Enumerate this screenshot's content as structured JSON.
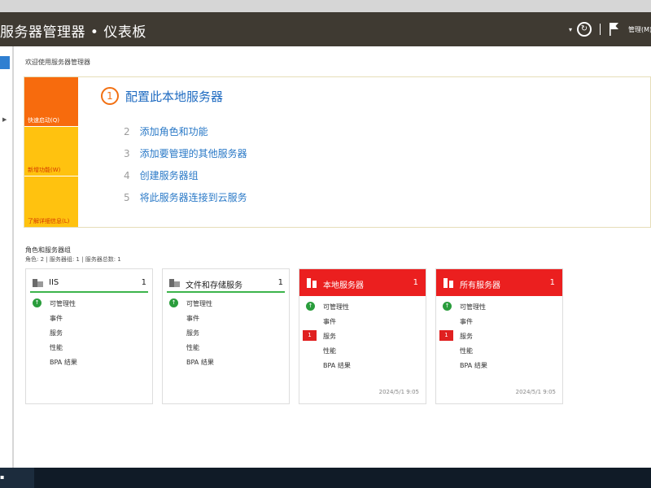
{
  "window": {
    "title": "服务器管理器 • 仪表板",
    "manage_label": "管理(M)"
  },
  "welcome": {
    "title": "欢迎使用服务器管理器",
    "quick_tiles": [
      "快速启动(Q)",
      "新增功能(W)",
      "了解详细信息(L)"
    ],
    "main_step": {
      "number": "1",
      "label": "配置此本地服务器"
    },
    "steps": [
      {
        "number": "2",
        "label": "添加角色和功能"
      },
      {
        "number": "3",
        "label": "添加要管理的其他服务器"
      },
      {
        "number": "4",
        "label": "创建服务器组"
      },
      {
        "number": "5",
        "label": "将此服务器连接到云服务"
      }
    ]
  },
  "roles": {
    "title": "角色和服务器组",
    "summary": "角色: 2 | 服务器组: 1 | 服务器总数: 1"
  },
  "row_labels": [
    "可管理性",
    "事件",
    "服务",
    "性能",
    "BPA 结果"
  ],
  "tiles": [
    {
      "name": "IIS",
      "count": "1",
      "status": "ok",
      "service_alert": "",
      "timestamp": ""
    },
    {
      "name": "文件和存储服务",
      "count": "1",
      "status": "ok",
      "service_alert": "",
      "timestamp": ""
    },
    {
      "name": "本地服务器",
      "count": "1",
      "status": "alert",
      "service_alert": "1",
      "timestamp": "2024/5/1 9:05"
    },
    {
      "name": "所有服务器",
      "count": "1",
      "status": "alert",
      "service_alert": "1",
      "timestamp": "2024/5/1 9:05"
    }
  ],
  "colors": {
    "titlebar": "#3f3a32",
    "orange": "#f76b0d",
    "yellow": "#ffc20f",
    "alert_red": "#eb1f1f",
    "ok_green": "#3cb44b",
    "link_blue": "#2a79c7"
  },
  "icons": {
    "refresh": "refresh-icon",
    "flag": "flag-icon",
    "dropdown": "chevron-down-icon"
  }
}
